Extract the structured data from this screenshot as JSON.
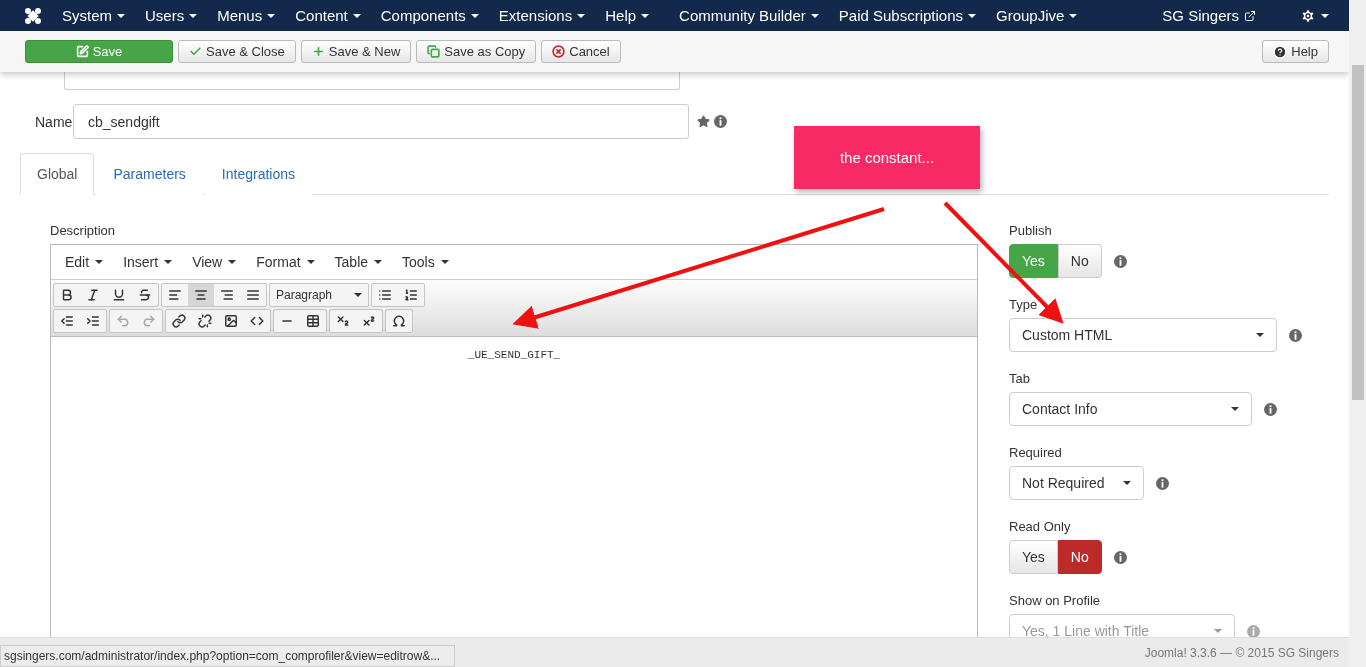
{
  "navbar": {
    "menus": [
      {
        "label": "System"
      },
      {
        "label": "Users"
      },
      {
        "label": "Menus"
      },
      {
        "label": "Content"
      },
      {
        "label": "Components"
      },
      {
        "label": "Extensions"
      },
      {
        "label": "Help"
      },
      {
        "label": "Community Builder"
      },
      {
        "label": "Paid Subscriptions"
      },
      {
        "label": "GroupJive"
      }
    ],
    "site_link": "SG Singers"
  },
  "toolbar": {
    "buttons": [
      {
        "label": "Save",
        "kind": "primary"
      },
      {
        "label": "Save & Close",
        "kind": "close"
      },
      {
        "label": "Save & New",
        "kind": "new"
      },
      {
        "label": "Save as Copy",
        "kind": "copy"
      },
      {
        "label": "Cancel",
        "kind": "cancel"
      }
    ],
    "help": "Help"
  },
  "form": {
    "name": {
      "label": "Name",
      "value": "cb_sendgift"
    }
  },
  "tabs": [
    {
      "label": "Global",
      "selected": true
    },
    {
      "label": "Parameters",
      "selected": false
    },
    {
      "label": "Integrations",
      "selected": false
    }
  ],
  "editor": {
    "label": "Description",
    "menus": [
      "Edit",
      "Insert",
      "View",
      "Format",
      "Table",
      "Tools"
    ],
    "format_select": "Paragraph",
    "align_buttons": [
      {
        "pressed": false
      },
      {
        "pressed": true
      },
      {
        "pressed": false
      },
      {
        "pressed": false
      }
    ],
    "content": "_UE_SEND_GIFT_"
  },
  "settings": [
    {
      "kind": "toggle",
      "label": "Publish",
      "options": [
        {
          "label": "Yes",
          "selected": true
        },
        {
          "label": "No",
          "selected": false
        }
      ]
    },
    {
      "kind": "select",
      "label": "Type",
      "value": "Custom HTML",
      "disabled": false
    },
    {
      "kind": "select",
      "label": "Tab",
      "value": "Contact Info",
      "disabled": false
    },
    {
      "kind": "select",
      "label": "Required",
      "value": "Not Required",
      "disabled": false
    },
    {
      "kind": "toggle",
      "label": "Read Only",
      "options": [
        {
          "label": "Yes",
          "selected": false
        },
        {
          "label": "No",
          "selected": true
        }
      ]
    },
    {
      "kind": "select",
      "label": "Show on Profile",
      "value": "Yes, 1 Line with Title",
      "disabled": true
    }
  ],
  "annotation": {
    "text": "the constant..."
  },
  "status_url": "sgsingers.com/administrator/index.php?option=com_comprofiler&view=editrow&...",
  "footer": "Joomla! 3.3.6 — © 2015 SG Singers"
}
